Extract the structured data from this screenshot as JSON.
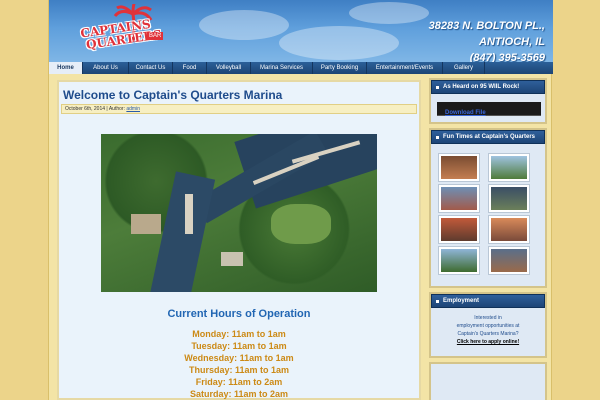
{
  "header": {
    "logo_line1": "CAPTAINS",
    "logo_line2": "QUARTERS",
    "logo_badge": "BAR",
    "address_line1": "38283 N. BOLTON PL.,",
    "address_line2": "ANTIOCH, IL",
    "phone": "(847) 395-3569"
  },
  "nav": {
    "items": [
      {
        "label": "Home",
        "active": true
      },
      {
        "label": "About Us"
      },
      {
        "label": "Contact Us"
      },
      {
        "label": "Food"
      },
      {
        "label": "Volleyball"
      },
      {
        "label": "Marina Services"
      },
      {
        "label": "Party Booking"
      },
      {
        "label": "Entertainment/Events"
      },
      {
        "label": "Gallery"
      }
    ]
  },
  "post": {
    "title": "Welcome to Captain's Quarters Marina",
    "date": "October 6th, 2014",
    "author_prefix": "| Author:",
    "author": "admin",
    "hours_title": "Current Hours of Operation",
    "hours": [
      "Monday: 11am to 1am",
      "Tuesday: 11am to 1am",
      "Wednesday: 11am to 1am",
      "Thursday: 11am to 1am",
      "Friday: 11am to 2am",
      "Saturday: 11am to 2am"
    ]
  },
  "sidebar": {
    "widget1_title": "As Heard on 95 WIIL Rock!",
    "download_label": "Download File",
    "widget2_title": "Fun Times at Captain's Quarters",
    "widget3_title": "Employment",
    "employ_line1": "Interested in",
    "employ_line2": "employment opportunities at",
    "employ_line3": "Captain's Quarters Marina?",
    "employ_link": "Click here to apply online!"
  },
  "colors": {
    "page_bg": "#ecd48a",
    "header_blue": "#3f7fc4",
    "nav_blue": "#1d4574",
    "title_blue": "#1f4c8c",
    "hours_gold": "#cc8a16"
  }
}
